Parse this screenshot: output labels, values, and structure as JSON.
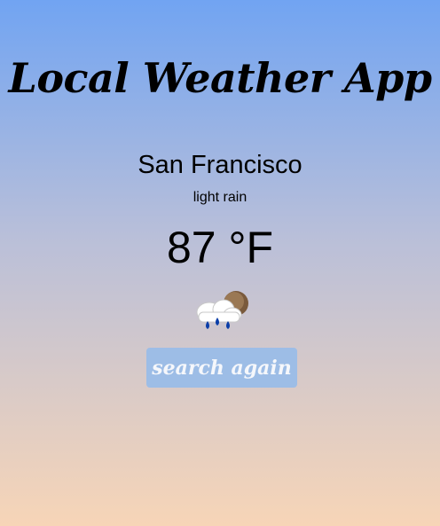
{
  "app": {
    "title": "Local Weather App"
  },
  "weather": {
    "city": "San Francisco",
    "condition": "light rain",
    "temperature": "87 °F",
    "icon": "rain-cloud-moon-icon"
  },
  "actions": {
    "search_again_label": "search again"
  },
  "colors": {
    "gradient_top": "#71a4f2",
    "gradient_bottom": "#f7d5b7",
    "button_bg": "#9dbde6"
  }
}
